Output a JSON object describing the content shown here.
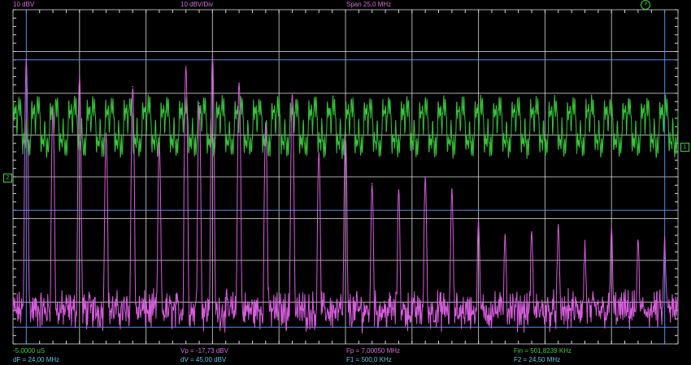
{
  "header": {
    "ref_level": "10 dBV",
    "scale": "10 dBV/Div",
    "span": "Span 25,0 MHz"
  },
  "footer": {
    "time_offset": "-5,0000 uS",
    "dF": "dF = 24,00 MHz",
    "Vp": "Vp = -17,73 dBV",
    "dV": "dV = 45,00 dBV",
    "Fp": "Fp = 7,00050 MHz",
    "F1": "F1 = 500,0 KHz",
    "Fin": "Fin = 501,8239 KHz",
    "F2": "F2 = 24,50 MHz"
  },
  "markers": {
    "channel_left": "2",
    "channel_right": "1"
  },
  "colors": {
    "grid": "#d9d9d9",
    "cursor": "#4a8fe8",
    "spectrum": "#d65ddc",
    "waveform": "#37c23a",
    "label_magenta": "#d86fe0",
    "label_green": "#3ad13a",
    "label_cyan": "#5fc8e6"
  },
  "icons": {
    "run_indicator": "clock-icon"
  },
  "chart_data": [
    {
      "type": "line",
      "name": "FFT spectrum",
      "xlabel": "",
      "ylabel": "",
      "xlim": [
        0,
        25.0
      ],
      "ylim": [
        -90,
        10
      ],
      "x_unit": "MHz",
      "y_unit": "dBV",
      "peaks": [
        {
          "x": 0.5,
          "y": -5
        },
        {
          "x": 1.5,
          "y": -20
        },
        {
          "x": 2.5,
          "y": -10
        },
        {
          "x": 3.5,
          "y": -27
        },
        {
          "x": 4.5,
          "y": -13
        },
        {
          "x": 5.5,
          "y": -30
        },
        {
          "x": 6.5,
          "y": -7
        },
        {
          "x": 7.0,
          "y": -18
        },
        {
          "x": 7.5,
          "y": -4
        },
        {
          "x": 8.5,
          "y": -12
        },
        {
          "x": 9.5,
          "y": -24
        },
        {
          "x": 10.5,
          "y": -15
        },
        {
          "x": 11.5,
          "y": -33
        },
        {
          "x": 12.5,
          "y": -28
        },
        {
          "x": 13.5,
          "y": -42
        },
        {
          "x": 14.5,
          "y": -44
        },
        {
          "x": 15.5,
          "y": -40
        },
        {
          "x": 16.5,
          "y": -44
        },
        {
          "x": 17.5,
          "y": -54
        },
        {
          "x": 18.5,
          "y": -58
        },
        {
          "x": 19.5,
          "y": -57
        },
        {
          "x": 20.5,
          "y": -55
        },
        {
          "x": 21.5,
          "y": -62
        },
        {
          "x": 22.5,
          "y": -56
        },
        {
          "x": 23.5,
          "y": -60
        },
        {
          "x": 24.5,
          "y": -59
        }
      ],
      "noise_floor": -80
    },
    {
      "type": "line",
      "name": "Time-domain waveform",
      "xlabel": "",
      "ylabel": "",
      "cycles": 36,
      "center_div": 2.8,
      "amplitude_div": 0.8
    }
  ],
  "cursors": {
    "vertical_freq_MHz": [
      0.5,
      24.5
    ],
    "horizontal_dBV": [
      -5,
      -50,
      -85
    ]
  }
}
